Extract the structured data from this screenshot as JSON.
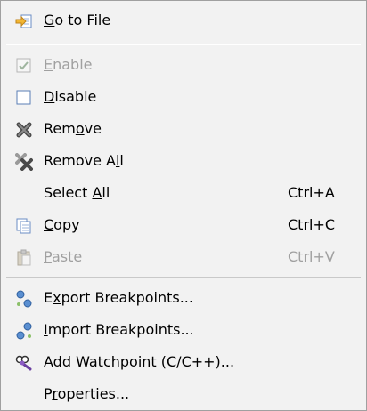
{
  "colors": {
    "background": "#f2f2f2",
    "text": "#000000",
    "disabled_text": "#a0a0a0",
    "separator": "#c9c9c9"
  },
  "menu": {
    "items": [
      {
        "pre": "",
        "mn": "G",
        "post": "o to File",
        "shortcut": "",
        "icon": "go-to-file-icon",
        "disabled": false
      },
      {
        "pre": "",
        "mn": "E",
        "post": "nable",
        "shortcut": "",
        "icon": "checkbox-checked-icon",
        "disabled": true
      },
      {
        "pre": "",
        "mn": "D",
        "post": "isable",
        "shortcut": "",
        "icon": "checkbox-empty-icon",
        "disabled": false
      },
      {
        "pre": "Rem",
        "mn": "o",
        "post": "ve",
        "shortcut": "",
        "icon": "remove-icon",
        "disabled": false
      },
      {
        "pre": "Remove A",
        "mn": "l",
        "post": "l",
        "shortcut": "",
        "icon": "remove-all-icon",
        "disabled": false
      },
      {
        "pre": "Select ",
        "mn": "A",
        "post": "ll",
        "shortcut": "Ctrl+A",
        "icon": "",
        "disabled": false
      },
      {
        "pre": "",
        "mn": "C",
        "post": "opy",
        "shortcut": "Ctrl+C",
        "icon": "copy-icon",
        "disabled": false
      },
      {
        "pre": "",
        "mn": "P",
        "post": "aste",
        "shortcut": "Ctrl+V",
        "icon": "paste-icon",
        "disabled": true
      },
      {
        "pre": "E",
        "mn": "x",
        "post": "port Breakpoints...",
        "shortcut": "",
        "icon": "export-breakpoints-icon",
        "disabled": false
      },
      {
        "pre": "",
        "mn": "I",
        "post": "mport Breakpoints...",
        "shortcut": "",
        "icon": "import-breakpoints-icon",
        "disabled": false
      },
      {
        "pre": "Add Watchpoint (C/C++)...",
        "mn": "",
        "post": "",
        "shortcut": "",
        "icon": "watchpoint-icon",
        "disabled": false
      },
      {
        "pre": "P",
        "mn": "r",
        "post": "operties...",
        "shortcut": "",
        "icon": "",
        "disabled": false
      }
    ]
  }
}
